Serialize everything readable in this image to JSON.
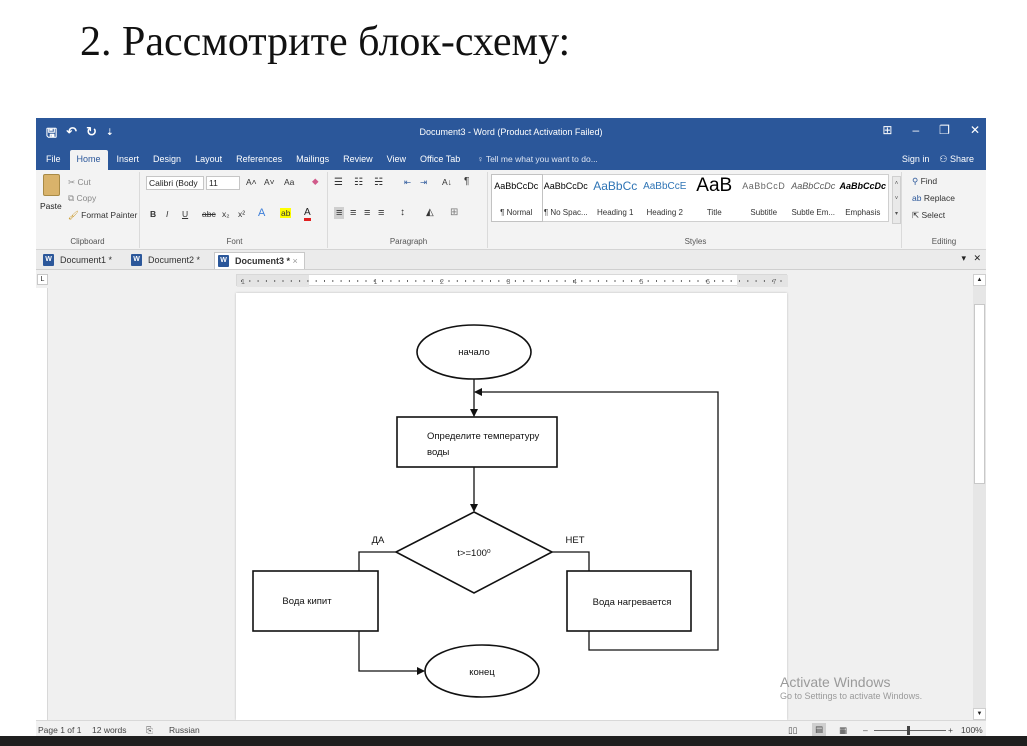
{
  "slide": {
    "title": "2. Рассмотрите блок-схему:"
  },
  "window": {
    "title": "Document3 - Word (Product Activation Failed)",
    "qat": {
      "save": "🖫",
      "undo": "↶",
      "redo": "↻",
      "customize": "⇣"
    },
    "controls": {
      "ribbon_display": "⊞",
      "minimize": "–",
      "restore": "❐",
      "close": "✕"
    }
  },
  "menu": {
    "tabs": [
      "File",
      "Home",
      "Insert",
      "Design",
      "Layout",
      "References",
      "Mailings",
      "Review",
      "View",
      "Office Tab"
    ],
    "tell_me": "Tell me what you want to do...",
    "sign_in": "Sign in",
    "share": "Share"
  },
  "ribbon": {
    "clipboard": {
      "paste": "Paste",
      "cut": "Cut",
      "copy": "Copy",
      "format_painter": "Format Painter",
      "label": "Clipboard"
    },
    "font": {
      "name": "Calibri (Body",
      "size": "11",
      "grow": "A˄",
      "shrink": "A˅",
      "change_case": "Aa",
      "bold": "B",
      "italic": "I",
      "underline": "U",
      "strike": "abc",
      "subscript": "x₂",
      "superscript": "x²",
      "text_effects": "A",
      "highlight": "ab",
      "font_color": "A",
      "label": "Font"
    },
    "paragraph": {
      "bullets": "☰",
      "numbering": "☷",
      "multilevel": "☵",
      "dec_indent": "⇤",
      "inc_indent": "⇥",
      "sort": "A↓",
      "pilcrow": "¶",
      "align_left": "≡",
      "center": "≡",
      "align_right": "≡",
      "justify": "≡",
      "line_spacing": "↕",
      "shading": "◭",
      "borders": "⊞",
      "label": "Paragraph"
    },
    "styles": {
      "items": [
        {
          "sample": "AaBbCcDc",
          "name": "¶ Normal"
        },
        {
          "sample": "AaBbCcDc",
          "name": "¶ No Spac..."
        },
        {
          "sample": "AaBbCc",
          "name": "Heading 1"
        },
        {
          "sample": "AaBbCcE",
          "name": "Heading 2"
        },
        {
          "sample": "AaB",
          "name": "Title"
        },
        {
          "sample": "AaBbCcD",
          "name": "Subtitle"
        },
        {
          "sample": "AaBbCcDc",
          "name": "Subtle Em..."
        },
        {
          "sample": "AaBbCcDc",
          "name": "Emphasis"
        }
      ],
      "label": "Styles"
    },
    "editing": {
      "find": "Find",
      "replace": "Replace",
      "select": "Select",
      "label": "Editing"
    }
  },
  "doc_tabs": [
    {
      "label": "Document1 *"
    },
    {
      "label": "Document2 *"
    },
    {
      "label": "Document3 *",
      "close": "×"
    }
  ],
  "doc_tabs_right": {
    "dropdown": "▾",
    "close": "✕"
  },
  "ruler": {
    "marks": [
      "1",
      "1",
      "2",
      "3",
      "4",
      "5",
      "6",
      "7"
    ]
  },
  "flowchart": {
    "start": "начало",
    "process": [
      "Определите температуру",
      "воды"
    ],
    "condition": "t>=100⁰",
    "yes": "ДА",
    "no": "НЕТ",
    "yes_box": "Вода кипит",
    "no_box": "Вода нагревается",
    "end": "конец"
  },
  "status": {
    "page": "Page 1 of 1",
    "words": "12 words",
    "language": "Russian",
    "zoom": "100%",
    "zoom_minus": "–",
    "zoom_plus": "+"
  },
  "watermark": {
    "line1": "Activate Windows",
    "line2": "Go to Settings to activate Windows."
  },
  "colors": {
    "accent": "#2b579a"
  }
}
